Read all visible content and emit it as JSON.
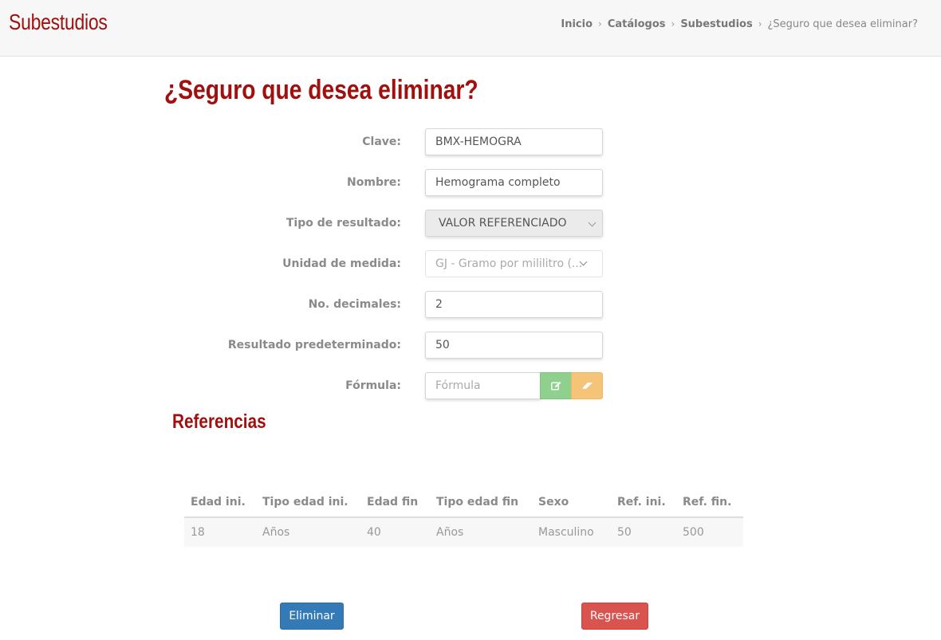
{
  "header": {
    "app_title": "Subestudios",
    "breadcrumb": [
      {
        "label": "Inicio"
      },
      {
        "label": "Catálogos"
      },
      {
        "label": "Subestudios"
      }
    ],
    "breadcrumb_current": "¿Seguro que desea eliminar?",
    "separator": "›"
  },
  "page": {
    "title": "¿Seguro que desea eliminar?"
  },
  "form": {
    "clave": {
      "label": "Clave:",
      "value": "BMX-HEMOGRA"
    },
    "nombre": {
      "label": "Nombre:",
      "value": "Hemograma completo"
    },
    "tipo_resultado": {
      "label": "Tipo de resultado:",
      "value": "VALOR REFERENCIADO"
    },
    "unidad_medida": {
      "label": "Unidad de medida:",
      "value": "GJ - Gramo por mililitro (..."
    },
    "decimales": {
      "label": "No. decimales:",
      "value": "2"
    },
    "resultado_predeterminado": {
      "label": "Resultado predeterminado:",
      "value": "50"
    },
    "formula": {
      "label": "Fórmula:",
      "placeholder": "Fórmula",
      "edit_icon": "pencil-square-icon",
      "clear_icon": "eraser-icon"
    }
  },
  "referencias": {
    "title": "Referencias",
    "columns": [
      "Edad ini.",
      "Tipo edad ini.",
      "Edad fin",
      "Tipo edad fin",
      "Sexo",
      "Ref. ini.",
      "Ref. fin."
    ],
    "rows": [
      [
        "18",
        "Años",
        "40",
        "Años",
        "Masculino",
        "50",
        "500"
      ]
    ]
  },
  "actions": {
    "delete_label": "Eliminar",
    "back_label": "Regresar"
  },
  "colors": {
    "brand_red": "#a0100f",
    "primary": "#337ab7",
    "danger": "#d9534f",
    "success": "#8fd08f",
    "warning": "#f5c478"
  }
}
